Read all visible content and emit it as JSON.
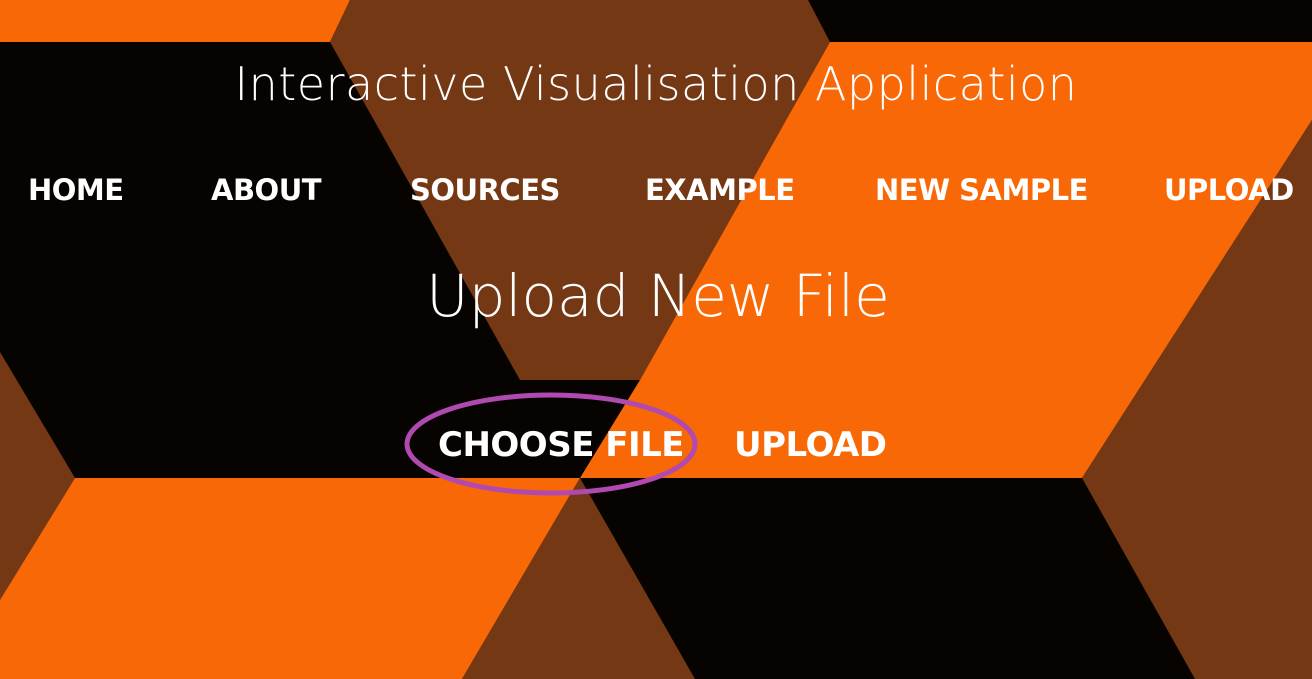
{
  "app_title": "Interactive Visualisation Application",
  "nav": {
    "items": [
      {
        "label": "HOME"
      },
      {
        "label": "ABOUT"
      },
      {
        "label": "SOURCES"
      },
      {
        "label": "EXAMPLE"
      },
      {
        "label": "NEW SAMPLE"
      },
      {
        "label": "UPLOAD"
      }
    ]
  },
  "page_title": "Upload New File",
  "actions": {
    "choose_file_label": "CHOOSE FILE",
    "upload_label": "UPLOAD"
  },
  "colors": {
    "orange": "#f96806",
    "brown": "#743814",
    "black": "#060301",
    "text": "#ffffff",
    "highlight_ring": "#b04ab0"
  }
}
